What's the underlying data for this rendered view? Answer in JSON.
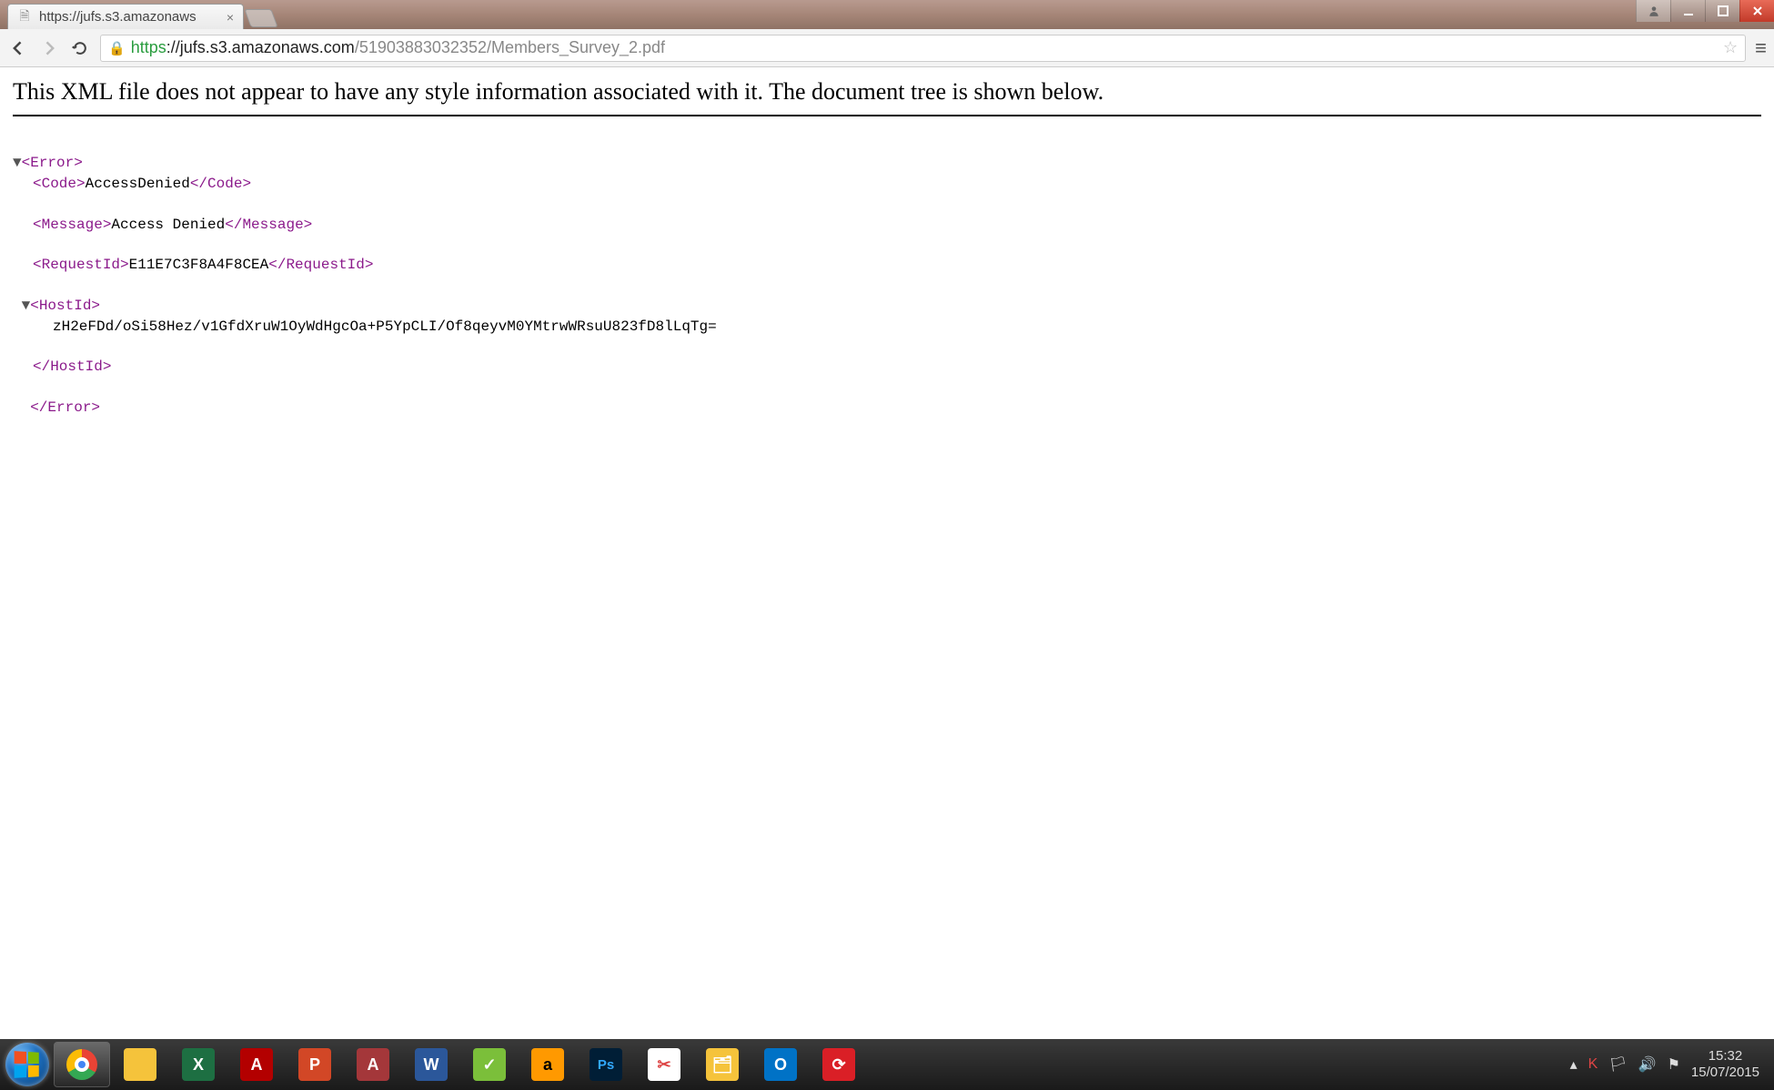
{
  "window": {
    "tab_title": "https://jufs.s3.amazonaws",
    "user_button_tooltip": "You"
  },
  "toolbar": {
    "url_scheme": "https",
    "url_host": "://jufs.s3.amazonaws.com",
    "url_path": "/51903883032352/Members_Survey_2.pdf"
  },
  "page": {
    "banner": "This XML file does not appear to have any style information associated with it. The document tree is shown below.",
    "xml": {
      "error_open": "<Error>",
      "code_open": "<Code>",
      "code_value": "AccessDenied",
      "code_close": "</Code>",
      "message_open": "<Message>",
      "message_value": "Access Denied",
      "message_close": "</Message>",
      "requestid_open": "<RequestId>",
      "requestid_value": "E11E7C3F8A4F8CEA",
      "requestid_close": "</RequestId>",
      "hostid_open": "<HostId>",
      "hostid_value": "zH2eFDd/oSi58Hez/v1GfdXruW1OyWdHgcOa+P5YpCLI/Of8qeyvM0YMtrwWRsuU823fD8lLqTg=",
      "hostid_close": "</HostId>",
      "error_close": "</Error>"
    }
  },
  "taskbar": {
    "apps": [
      {
        "name": "chrome",
        "label": "",
        "bg": "",
        "active": true
      },
      {
        "name": "explorer",
        "label": "",
        "bg": "#f5c33b"
      },
      {
        "name": "excel",
        "label": "X",
        "bg": "#1d6f42"
      },
      {
        "name": "adobe-reader",
        "label": "A",
        "bg": "#b30000"
      },
      {
        "name": "powerpoint",
        "label": "P",
        "bg": "#d24726"
      },
      {
        "name": "access",
        "label": "A",
        "bg": "#a4373a"
      },
      {
        "name": "word",
        "label": "W",
        "bg": "#2b579a"
      },
      {
        "name": "app-green",
        "label": "✓",
        "bg": "#7bbf3a"
      },
      {
        "name": "amazon",
        "label": "a",
        "bg": "#ff9900"
      },
      {
        "name": "photoshop",
        "label": "Ps",
        "bg": "#001e36"
      },
      {
        "name": "snipping",
        "label": "✂",
        "bg": "#ffffff"
      },
      {
        "name": "files",
        "label": "🗂",
        "bg": "#f5c33b"
      },
      {
        "name": "outlook",
        "label": "O",
        "bg": "#0072c6"
      },
      {
        "name": "creative-cloud",
        "label": "⟳",
        "bg": "#da1f26"
      }
    ],
    "tray_arrow": "▴",
    "clock_time": "15:32",
    "clock_date": "15/07/2015"
  }
}
